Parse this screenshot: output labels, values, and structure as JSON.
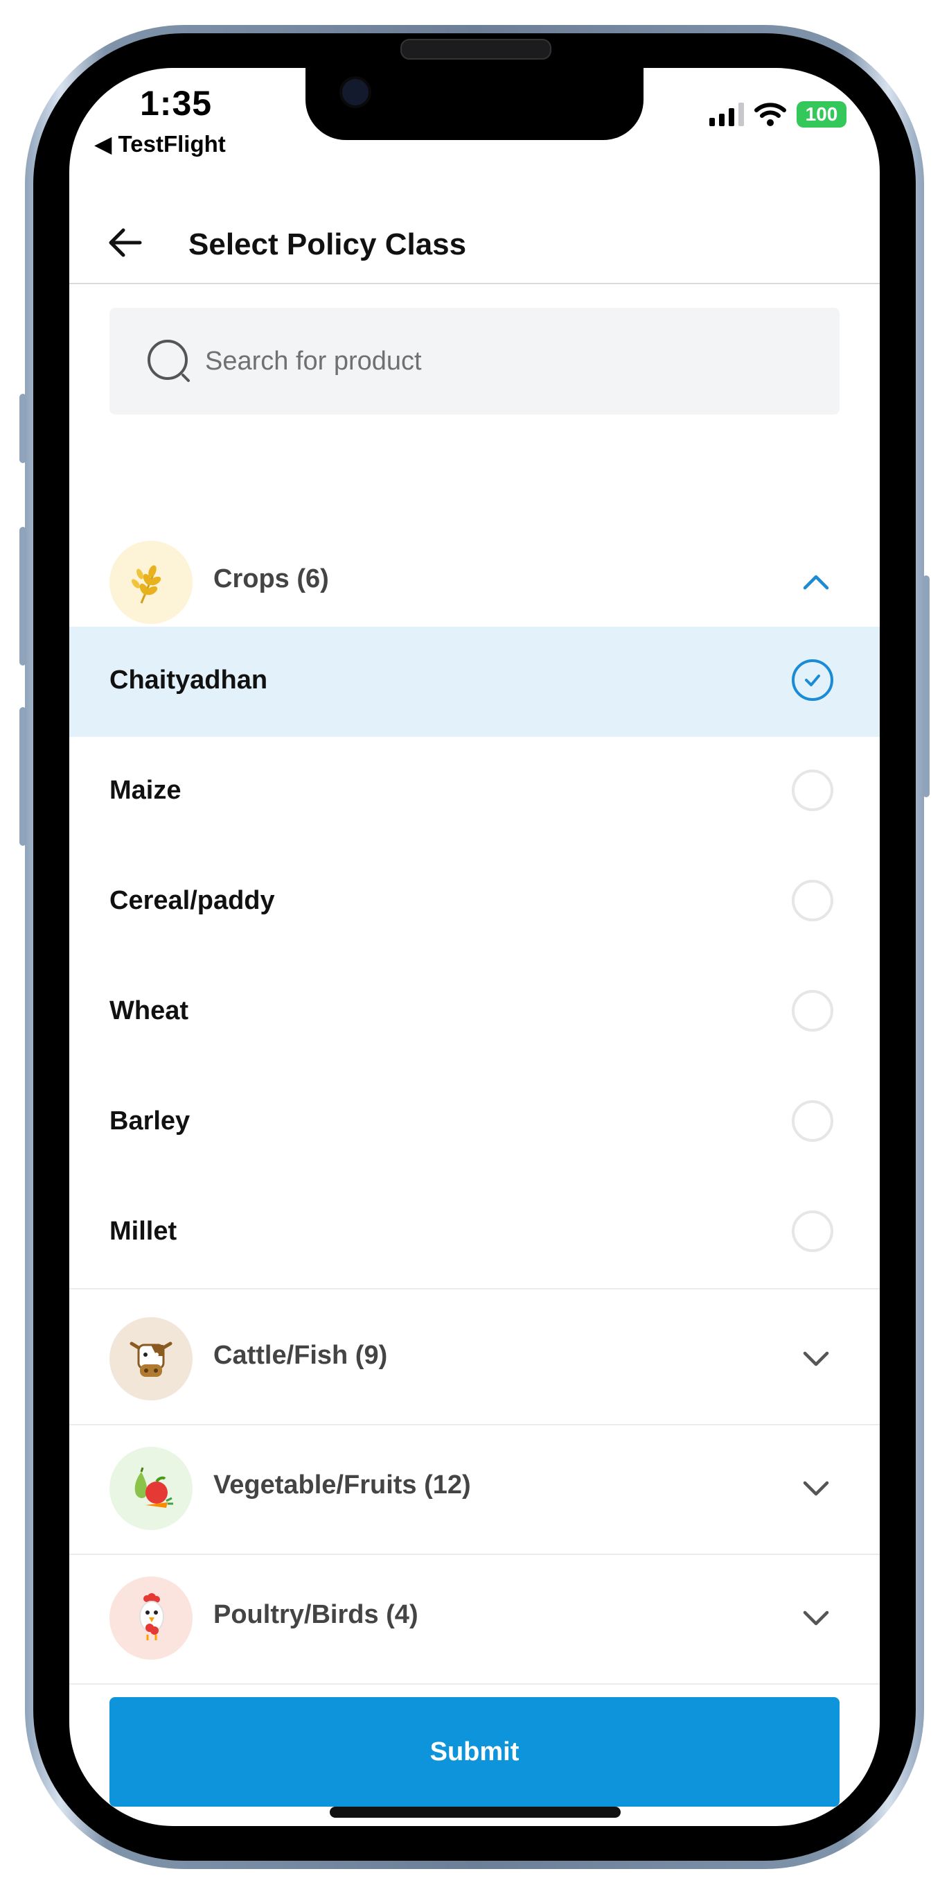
{
  "status_bar": {
    "time": "1:35",
    "back_app": "◀ TestFlight",
    "battery": "100"
  },
  "header": {
    "title": "Select Policy Class"
  },
  "search": {
    "placeholder": "Search for product"
  },
  "categories": [
    {
      "label": "Crops (6)",
      "icon": "wheat-icon",
      "expanded": true,
      "items": [
        {
          "label": "Chaityadhan",
          "selected": true
        },
        {
          "label": "Maize",
          "selected": false
        },
        {
          "label": "Cereal/paddy",
          "selected": false
        },
        {
          "label": "Wheat",
          "selected": false
        },
        {
          "label": "Barley",
          "selected": false
        },
        {
          "label": "Millet",
          "selected": false
        }
      ]
    },
    {
      "label": "Cattle/Fish (9)",
      "icon": "cow-icon",
      "expanded": false
    },
    {
      "label": "Vegetable/Fruits (12)",
      "icon": "fruit-icon",
      "expanded": false
    },
    {
      "label": "Poultry/Birds (4)",
      "icon": "chicken-icon",
      "expanded": false
    }
  ],
  "submit_label": "Submit",
  "colors": {
    "accent": "#0d94db",
    "selected_row": "#e2f1fa",
    "search_bg": "#f3f4f6",
    "battery": "#34c759"
  }
}
